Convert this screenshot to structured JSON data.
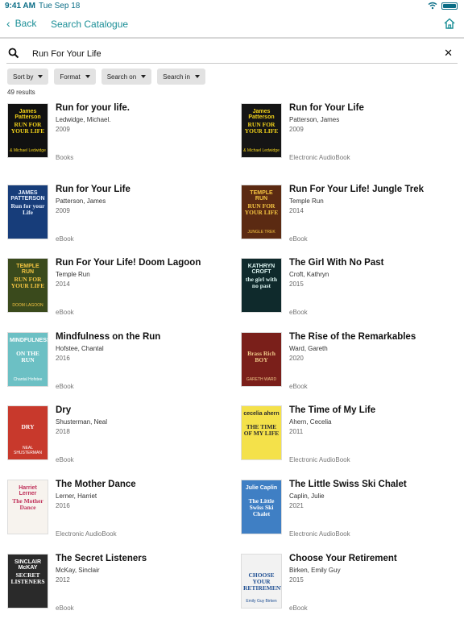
{
  "status": {
    "time": "9:41 AM",
    "date": "Tue Sep 18"
  },
  "nav": {
    "back_label": "Back",
    "title": "Search Catalogue"
  },
  "search": {
    "value": "Run For Your Life"
  },
  "filters": [
    {
      "label": "Sort by"
    },
    {
      "label": "Format"
    },
    {
      "label": "Search on"
    },
    {
      "label": "Search in"
    }
  ],
  "results_count": "49 results",
  "results": [
    {
      "title": "Run for your life.",
      "author": "Ledwidge, Michael.",
      "year": "2009",
      "format": "Books",
      "cover_top": "James Patterson",
      "cover_main": "RUN FOR YOUR LIFE",
      "cover_bottom": "& Michael Ledwidge",
      "cover_bg": "#111111",
      "cover_fg": "#f2d21a"
    },
    {
      "title": "Run for Your Life",
      "author": "Patterson, James",
      "year": "2009",
      "format": "Electronic AudioBook",
      "cover_top": "James Patterson",
      "cover_main": "RUN FOR YOUR LIFE",
      "cover_bottom": "& Michael Ledwidge",
      "cover_bg": "#151515",
      "cover_fg": "#f2d21a"
    },
    {
      "title": "Run for Your Life",
      "author": "Patterson, James",
      "year": "2009",
      "format": "eBook",
      "cover_top": "JAMES PATTERSON",
      "cover_main": "Run for your Life",
      "cover_bottom": "",
      "cover_bg": "#173d7a",
      "cover_fg": "#e8f0ff"
    },
    {
      "title": "Run For Your Life! Jungle Trek",
      "author": "Temple Run",
      "year": "2014",
      "format": "eBook",
      "cover_top": "TEMPLE RUN",
      "cover_main": "RUN FOR YOUR LIFE",
      "cover_bottom": "JUNGLE TREK",
      "cover_bg": "#5b2a12",
      "cover_fg": "#f5c542"
    },
    {
      "title": "Run For Your Life! Doom Lagoon",
      "author": "Temple Run",
      "year": "2014",
      "format": "eBook",
      "cover_top": "TEMPLE RUN",
      "cover_main": "RUN FOR YOUR LIFE",
      "cover_bottom": "DOOM LAGOON",
      "cover_bg": "#3a4a1c",
      "cover_fg": "#f5c542"
    },
    {
      "title": "The Girl With No Past",
      "author": "Croft, Kathryn",
      "year": "2015",
      "format": "eBook",
      "cover_top": "KATHRYN CROFT",
      "cover_main": "the girl with no past",
      "cover_bottom": "",
      "cover_bg": "#0f2a2c",
      "cover_fg": "#d9f1ee"
    },
    {
      "title": "Mindfulness on the Run",
      "author": "Hofstee, Chantal",
      "year": "2016",
      "format": "eBook",
      "cover_top": "MINDFULNESS",
      "cover_main": "ON THE RUN",
      "cover_bottom": "Chantal Hofstee",
      "cover_bg": "#6cc0c4",
      "cover_fg": "#ffffff"
    },
    {
      "title": "The Rise of the Remarkables",
      "author": "Ward, Gareth",
      "year": "2020",
      "format": "eBook",
      "cover_top": "",
      "cover_main": "Brass Rich BOY",
      "cover_bottom": "GARETH WARD",
      "cover_bg": "#7a1f1a",
      "cover_fg": "#f0c98a"
    },
    {
      "title": "Dry",
      "author": "Shusterman, Neal",
      "year": "2018",
      "format": "eBook",
      "cover_top": "",
      "cover_main": "DRY",
      "cover_bottom": "NEAL SHUSTERMAN",
      "cover_bg": "#c8392c",
      "cover_fg": "#ffffff"
    },
    {
      "title": "The Time of My Life",
      "author": "Ahern, Cecelia",
      "year": "2011",
      "format": "Electronic AudioBook",
      "cover_top": "cecelia ahern",
      "cover_main": "THE TIME OF MY LIFE",
      "cover_bottom": "",
      "cover_bg": "#f4e14a",
      "cover_fg": "#2c2c2c"
    },
    {
      "title": "The Mother Dance",
      "author": "Lerner, Harriet",
      "year": "2016",
      "format": "Electronic AudioBook",
      "cover_top": "Harriet Lerner",
      "cover_main": "The Mother Dance",
      "cover_bottom": "",
      "cover_bg": "#f7f3ee",
      "cover_fg": "#c0325b"
    },
    {
      "title": "The Little Swiss Ski Chalet",
      "author": "Caplin, Julie",
      "year": "2021",
      "format": "Electronic AudioBook",
      "cover_top": "Julie Caplin",
      "cover_main": "The Little Swiss Ski Chalet",
      "cover_bottom": "",
      "cover_bg": "#3f7fc4",
      "cover_fg": "#ffffff"
    },
    {
      "title": "The Secret Listeners",
      "author": "McKay, Sinclair",
      "year": "2012",
      "format": "eBook",
      "cover_top": "SINCLAIR McKAY",
      "cover_main": "SECRET LISTENERS",
      "cover_bottom": "",
      "cover_bg": "#2a2a2a",
      "cover_fg": "#ffffff"
    },
    {
      "title": "Choose Your Retirement",
      "author": "Birken, Emily Guy",
      "year": "2015",
      "format": "eBook",
      "cover_top": "",
      "cover_main": "CHOOSE YOUR RETIREMENT",
      "cover_bottom": "Emily Guy Birken",
      "cover_bg": "#f2f2f2",
      "cover_fg": "#1f4f93"
    }
  ],
  "colors": {
    "accent": "#1a8e96",
    "filter_bg": "#e2e2e2"
  }
}
